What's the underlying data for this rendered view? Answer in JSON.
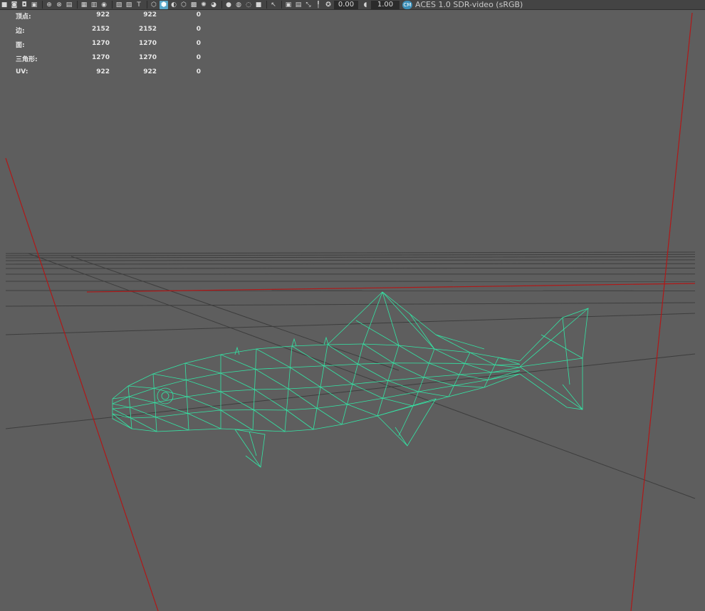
{
  "toolbar": {
    "exposure_value": "0.00",
    "gamma_value": "1.00",
    "color_management_label": "ACES 1.0 SDR-video (sRGB)",
    "icons": [
      "camera-select-icon",
      "camera-attributes-icon",
      "bookmarks-icon",
      "image-plane-icon",
      "grid-toggle-icon",
      "film-gate-icon",
      "resolution-gate-icon",
      "safe-action-icon",
      "field-chart-icon",
      "wireframe-icon",
      "smooth-shade-icon",
      "default-material-icon",
      "textured-icon",
      "use-lights-icon",
      "shadows-icon",
      "ambient-occlusion-icon",
      "motion-blur-icon",
      "anti-alias-icon",
      "xray-icon",
      "isolate-select-icon",
      "exposure-icon",
      "gamma-icon",
      "color-management-icon"
    ]
  },
  "hud": {
    "rows": [
      {
        "label": "顶点:",
        "v1": "922",
        "v2": "922",
        "v3": "0"
      },
      {
        "label": "边:",
        "v1": "2152",
        "v2": "2152",
        "v3": "0"
      },
      {
        "label": "面:",
        "v1": "1270",
        "v2": "1270",
        "v3": "0"
      },
      {
        "label": "三角形:",
        "v1": "1270",
        "v2": "1270",
        "v3": "0"
      },
      {
        "label": "UV:",
        "v1": "922",
        "v2": "922",
        "v3": "0"
      }
    ]
  },
  "viewport": {
    "background_color": "#5e5e5e",
    "grid_color": "#3d3d3d",
    "axis_color": "#b01818",
    "wireframe_color": "#33e6a5"
  }
}
